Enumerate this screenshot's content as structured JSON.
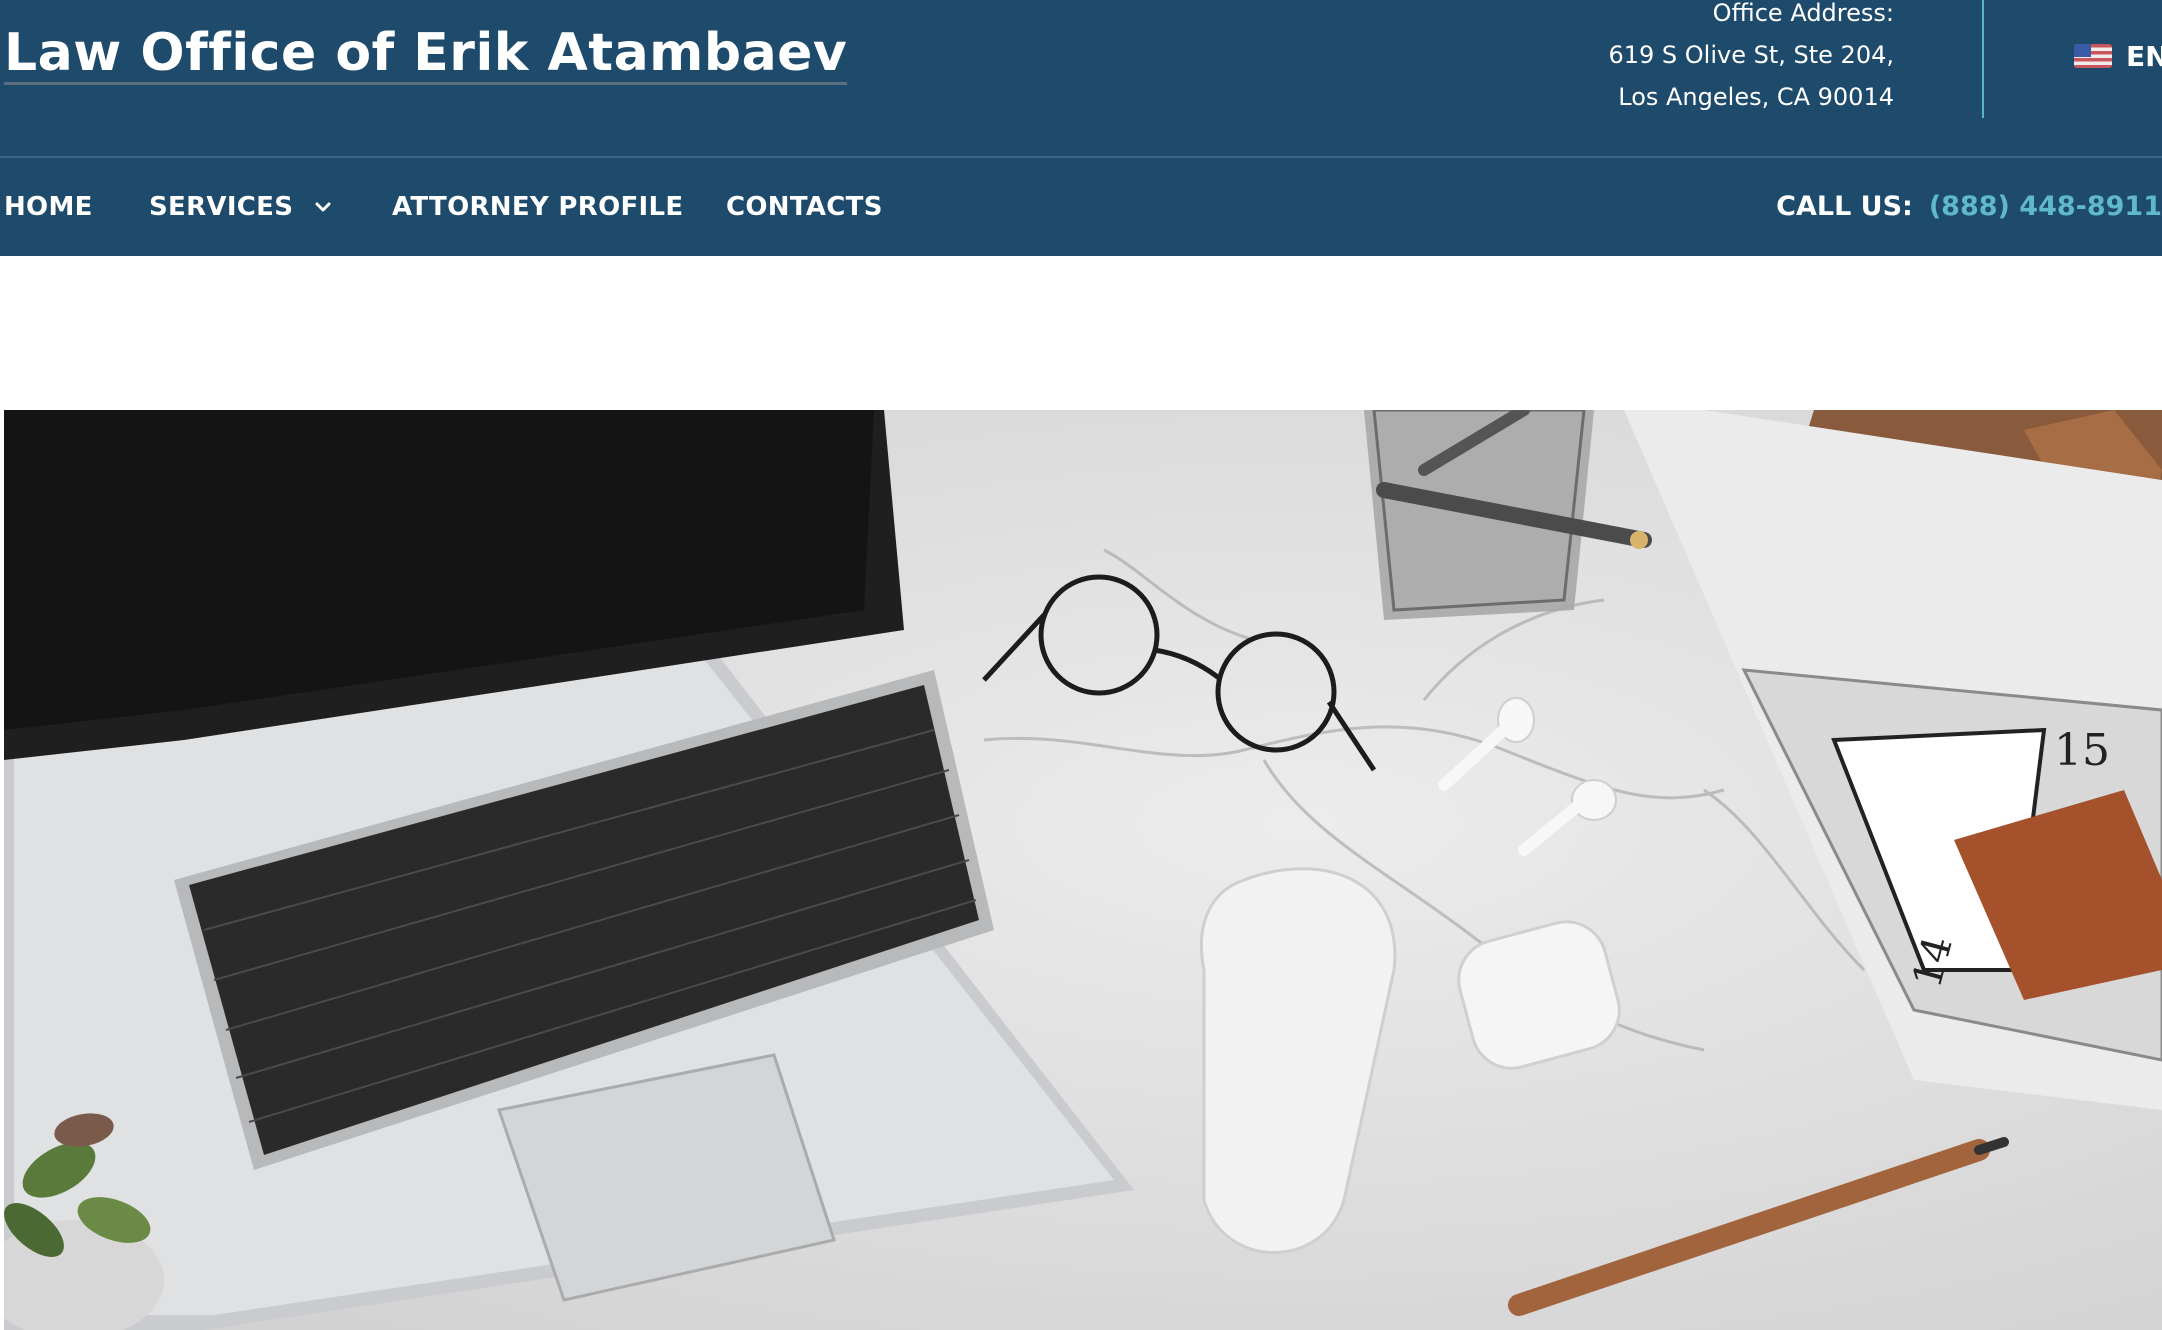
{
  "header": {
    "site_title": "Law Office of Erik Atambaev",
    "address": {
      "label": "Office Address:",
      "line1": "619 S Olive St, Ste 204,",
      "line2": "Los Angeles, CA 90014"
    },
    "language": {
      "flag_icon": "us-flag-icon",
      "code": "EN"
    }
  },
  "nav": {
    "items": [
      {
        "label": "HOME"
      },
      {
        "label": "SERVICES",
        "has_dropdown": true
      },
      {
        "label": "ATTORNEY PROFILE"
      },
      {
        "label": "CONTACTS"
      }
    ],
    "call_label": "CALL US:",
    "phone": "(888) 448-8911"
  },
  "hero": {
    "image_subject": "workspace-desk-photo"
  },
  "colors": {
    "header_bg": "#1e4a6b",
    "accent": "#5fb8cb",
    "text": "#ffffff"
  }
}
